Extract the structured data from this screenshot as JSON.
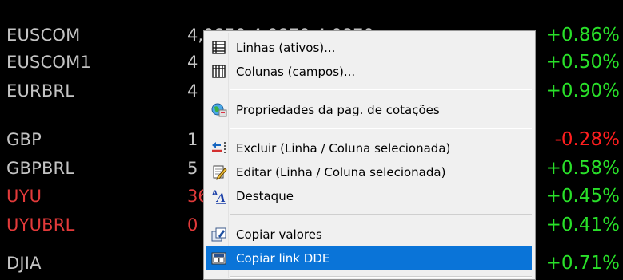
{
  "quotes": [
    {
      "symbol": "EUSCOM",
      "price": "4,0850   4,0870   4,0870",
      "change": "+0.86%",
      "symbol_color": "gray",
      "change_color": "green"
    },
    {
      "symbol": "EUSCOM1",
      "price": "4",
      "change": "+0.50%",
      "symbol_color": "gray",
      "change_color": "green"
    },
    {
      "symbol": "EURBRL",
      "price": "4",
      "change": "+0.90%",
      "symbol_color": "gray",
      "change_color": "green"
    },
    {
      "symbol": "GBP",
      "price": "1",
      "change": "-0.28%",
      "symbol_color": "gray",
      "change_color": "red"
    },
    {
      "symbol": "GBPBRL",
      "price": "5",
      "change": "+0.58%",
      "symbol_color": "gray",
      "change_color": "green"
    },
    {
      "symbol": "UYU",
      "price": "36",
      "change": "+0.45%",
      "symbol_color": "red",
      "change_color": "green"
    },
    {
      "symbol": "UYUBRL",
      "price": "0",
      "change": "+0.41%",
      "symbol_color": "red",
      "change_color": "green"
    },
    {
      "symbol": "DJIA",
      "price": "",
      "change": "+0.71%",
      "symbol_color": "gray",
      "change_color": "green"
    }
  ],
  "context_menu": {
    "items": [
      {
        "label": "Linhas (ativos)...",
        "icon": "rows-table-icon"
      },
      {
        "label": "Colunas (campos)...",
        "icon": "columns-table-icon"
      },
      {
        "label": "Propriedades da pag. de cotações",
        "icon": "properties-globe-icon"
      },
      {
        "label": "Excluir (Linha / Coluna selecionada)",
        "icon": "delete-column-icon"
      },
      {
        "label": "Editar (Linha / Coluna selecionada)",
        "icon": "edit-document-icon"
      },
      {
        "label": "Destaque",
        "icon": "highlight-font-icon"
      },
      {
        "label": "Copiar valores",
        "icon": "copy-values-icon"
      },
      {
        "label": "Copiar link DDE",
        "icon": "dde-link-icon"
      }
    ],
    "highlighted": "Copiar link DDE"
  },
  "colors": {
    "green": "#29e029",
    "red": "#e23a3a",
    "gray": "#c4c4c4",
    "highlight": "#0a74d8"
  }
}
